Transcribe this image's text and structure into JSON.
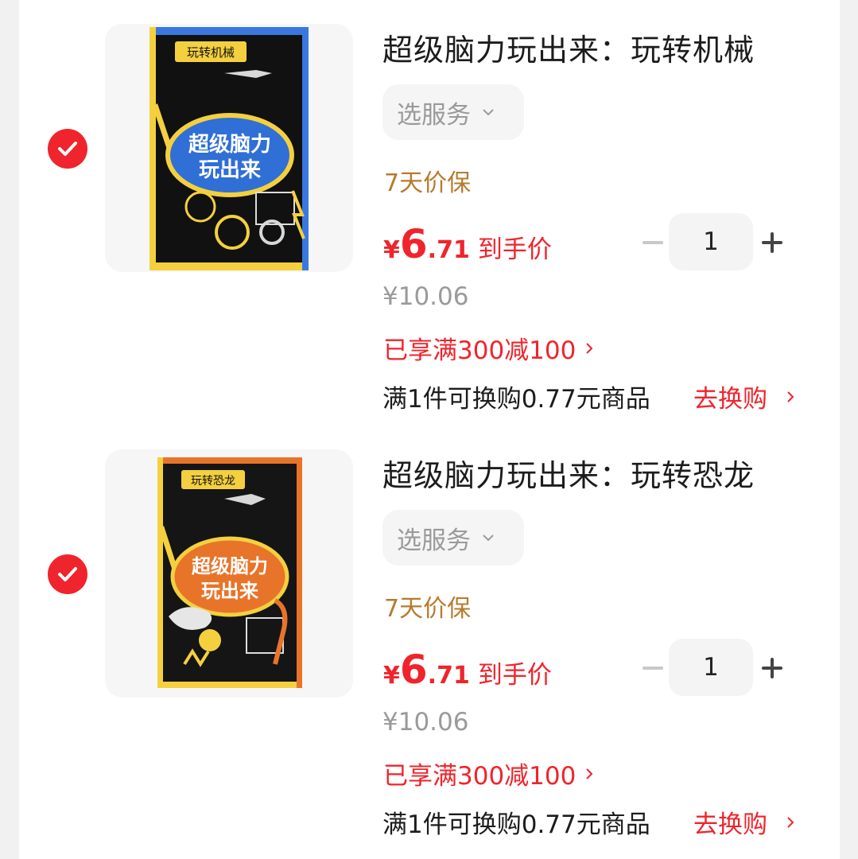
{
  "colors": {
    "accent": "#f0242c",
    "protect": "#b77a2c",
    "muted": "#9a9a9a"
  },
  "items": [
    {
      "title": "超级脑力玩出来：玩转机械",
      "service_label": "选服务",
      "protect_label": "7天价保",
      "price": {
        "currency": "¥",
        "integer": "6",
        "decimal": ".71",
        "label": "到手价"
      },
      "quantity": "1",
      "original_price": "¥10.06",
      "promo": "已享满300减100",
      "exchange_text": "满1件可换购0.77元商品",
      "exchange_link": "去换购",
      "cover": {
        "tag": "玩转机械",
        "title_line1": "超级脑力",
        "title_line2": "玩出来",
        "color": "#2f6fd6"
      }
    },
    {
      "title": "超级脑力玩出来：玩转恐龙",
      "service_label": "选服务",
      "protect_label": "7天价保",
      "price": {
        "currency": "¥",
        "integer": "6",
        "decimal": ".71",
        "label": "到手价"
      },
      "quantity": "1",
      "original_price": "¥10.06",
      "promo": "已享满300减100",
      "exchange_text": "满1件可换购0.77元商品",
      "exchange_link": "去换购",
      "cover": {
        "tag": "玩转恐龙",
        "title_line1": "超级脑力",
        "title_line2": "玩出来",
        "color": "#e8742a"
      }
    }
  ]
}
